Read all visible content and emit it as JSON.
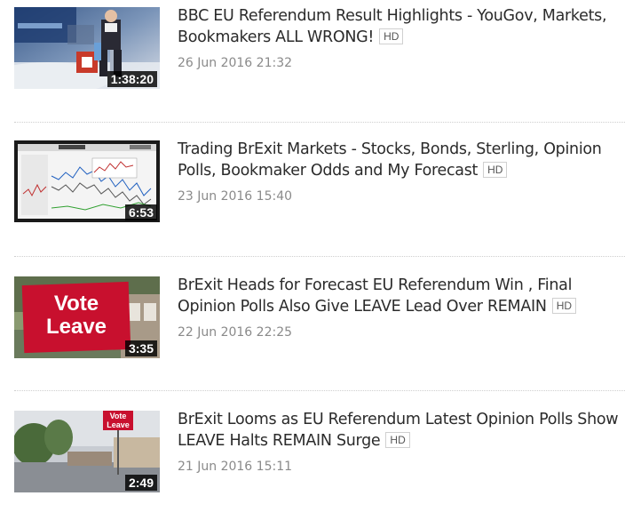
{
  "videos": [
    {
      "title": "BBC EU Referendum Result Highlights - YouGov, Markets, Bookmakers ALL WRONG!",
      "badge": "HD",
      "date": "26 Jun 2016 21:32",
      "duration": "1:38:20"
    },
    {
      "title": "Trading BrExit Markets - Stocks, Bonds, Sterling, Opinion Polls, Bookmaker Odds and My Forecast",
      "badge": "HD",
      "date": "23 Jun 2016 15:40",
      "duration": "6:53"
    },
    {
      "title": "BrExit Heads for Forecast EU Referendum Win , Final Opinion Polls Also Give LEAVE Lead Over REMAIN",
      "badge": "HD",
      "date": "22 Jun 2016 22:25",
      "duration": "3:35",
      "thumb_sign": [
        "Vote",
        "Leave"
      ]
    },
    {
      "title": "BrExit Looms as EU Referendum Latest Opinion Polls Show LEAVE Halts REMAIN Surge",
      "badge": "HD",
      "date": "21 Jun 2016 15:11",
      "duration": "2:49",
      "thumb_sign": [
        "Vote",
        "Leave"
      ]
    }
  ],
  "colors": {
    "title": "#2b2b2b",
    "date": "#8a8a8a",
    "sign_red": "#c8102e"
  }
}
